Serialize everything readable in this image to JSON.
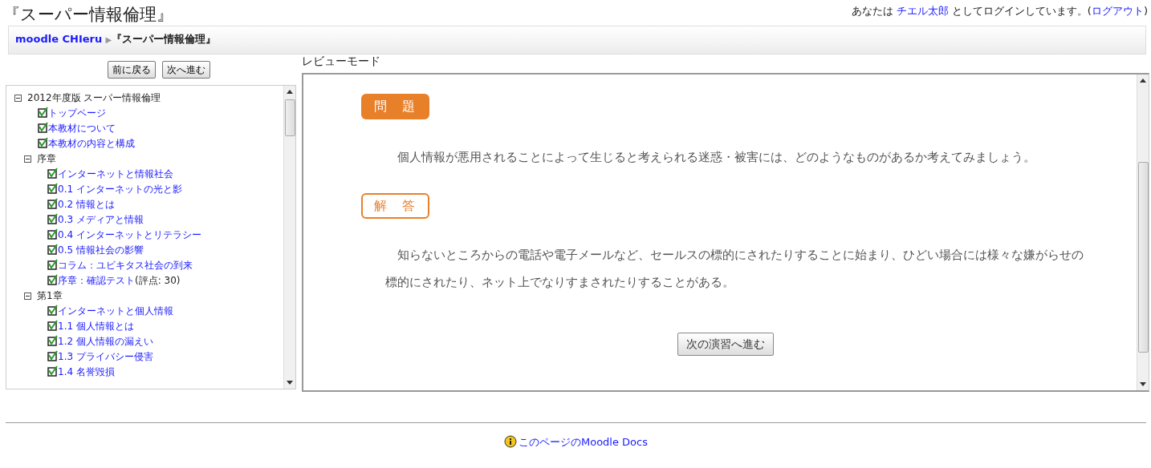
{
  "page_title": "『スーパー情報倫理』",
  "login": {
    "prefix": "あなたは",
    "user": "チエル太郎",
    "middle": "としてログインしています。(",
    "logout": "ログアウト",
    "suffix": ")"
  },
  "breadcrumb": {
    "home": "moodle CHIeru",
    "separator": "▶",
    "current": "『スーパー情報倫理』"
  },
  "nav_buttons": [
    "前に戻る",
    "次へ進む"
  ],
  "mode_label": "レビューモード",
  "toc": [
    {
      "label": "2012年度版  スーパー情報倫理",
      "kind": "folder",
      "expanded": true,
      "children": [
        {
          "label": "トップページ",
          "kind": "page",
          "checked": true
        },
        {
          "label": "本教材について",
          "kind": "page",
          "checked": true
        },
        {
          "label": "本教材の内容と構成",
          "kind": "page",
          "checked": true
        },
        {
          "label": "序章",
          "kind": "folder",
          "expanded": true,
          "children": [
            {
              "label": "インターネットと情報社会",
              "kind": "page",
              "checked": true
            },
            {
              "label": "0.1 インターネットの光と影",
              "kind": "page",
              "checked": true
            },
            {
              "label": "0.2 情報とは",
              "kind": "page",
              "checked": true
            },
            {
              "label": "0.3 メディアと情報",
              "kind": "page",
              "checked": true
            },
            {
              "label": "0.4 インターネットとリテラシー",
              "kind": "page",
              "checked": true
            },
            {
              "label": "0.5 情報社会の影響",
              "kind": "page",
              "checked": true
            },
            {
              "label": "コラム：ユビキタス社会の到来",
              "kind": "page",
              "checked": true
            },
            {
              "label": "序章：確認テスト",
              "kind": "page",
              "checked": true,
              "grade": "(評点: 30)"
            }
          ]
        },
        {
          "label": "第1章",
          "kind": "folder",
          "expanded": true,
          "children": [
            {
              "label": "インターネットと個人情報",
              "kind": "page",
              "checked": true
            },
            {
              "label": "1.1 個人情報とは",
              "kind": "page",
              "checked": true
            },
            {
              "label": "1.2 個人情報の漏えい",
              "kind": "page",
              "checked": true
            },
            {
              "label": "1.3 プライバシー侵害",
              "kind": "page",
              "checked": true
            },
            {
              "label": "1.4 名誉毀損",
              "kind": "page",
              "checked": true
            }
          ]
        }
      ]
    }
  ],
  "sections": [
    {
      "kind": "filled",
      "heading": "問　題",
      "text": "個人情報が悪用されることによって生じると考えられる迷惑・被害には、どのようなものがあるか考えてみましょう。"
    },
    {
      "kind": "outline",
      "heading": "解　答",
      "text": "知らないところからの電話や電子メールなど、セールスの標的にされたりすることに始まり、ひどい場合には様々な嫌がらせの標的にされたり、ネット上でなりすまされたりすることがある。"
    }
  ],
  "next_button": "次の演習へ進む",
  "footer_link": "このページのMoodle Docs"
}
